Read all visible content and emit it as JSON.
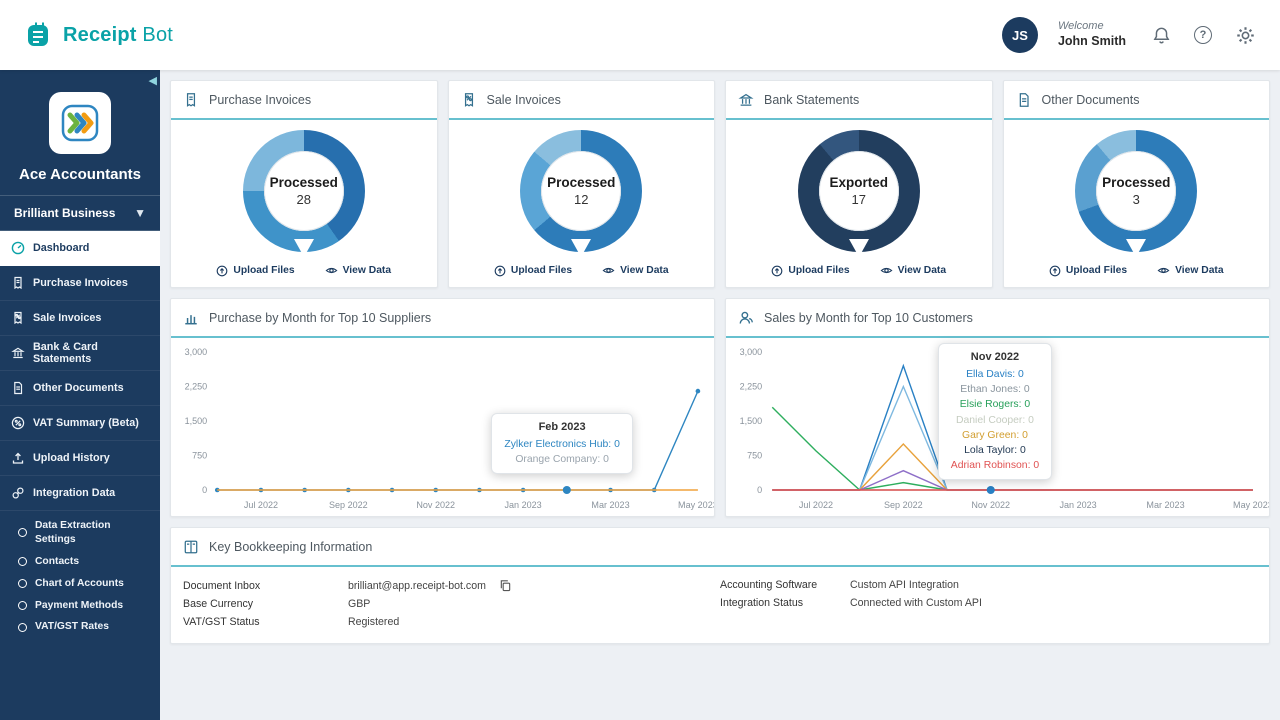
{
  "header": {
    "brand_primary": "Receipt",
    "brand_secondary": "Bot",
    "avatar_initials": "JS",
    "welcome_label": "Welcome",
    "user_name": "John Smith"
  },
  "sidebar": {
    "account_name": "Ace Accountants",
    "business_selector": "Brilliant Business",
    "items": [
      {
        "label": "Dashboard"
      },
      {
        "label": "Purchase Invoices"
      },
      {
        "label": "Sale Invoices"
      },
      {
        "label": "Bank & Card Statements"
      },
      {
        "label": "Other Documents"
      },
      {
        "label": "VAT Summary (Beta)"
      },
      {
        "label": "Upload History"
      },
      {
        "label": "Integration Data"
      }
    ],
    "integration_sub_items": [
      {
        "label": "Data Extraction Settings"
      },
      {
        "label": "Contacts"
      },
      {
        "label": "Chart of Accounts"
      },
      {
        "label": "Payment Methods"
      },
      {
        "label": "VAT/GST Rates"
      }
    ]
  },
  "summary_cards": [
    {
      "title": "Purchase Invoices",
      "status": "Processed",
      "count": "28",
      "upload_label": "Upload Files",
      "view_label": "View Data",
      "donut": {
        "segments": [
          {
            "color": "#276fae",
            "deg": 145
          },
          {
            "color": "#3f93c9",
            "deg": 125
          },
          {
            "color": "#7db7dc",
            "deg": 90
          }
        ]
      }
    },
    {
      "title": "Sale Invoices",
      "status": "Processed",
      "count": "12",
      "upload_label": "Upload Files",
      "view_label": "View Data",
      "donut": {
        "segments": [
          {
            "color": "#2d7cb9",
            "deg": 230
          },
          {
            "color": "#5aa5d6",
            "deg": 80
          },
          {
            "color": "#8abede",
            "deg": 50
          }
        ]
      }
    },
    {
      "title": "Bank Statements",
      "status": "Exported",
      "count": "17",
      "upload_label": "Upload Files",
      "view_label": "View Data",
      "donut": {
        "segments": [
          {
            "color": "#223e5e",
            "deg": 320
          },
          {
            "color": "#33567e",
            "deg": 40
          }
        ]
      }
    },
    {
      "title": "Other Documents",
      "status": "Processed",
      "count": "3",
      "upload_label": "Upload Files",
      "view_label": "View Data",
      "donut": {
        "segments": [
          {
            "color": "#2d7cb9",
            "deg": 250
          },
          {
            "color": "#5aa0d0",
            "deg": 70
          },
          {
            "color": "#8abede",
            "deg": 40
          }
        ]
      }
    }
  ],
  "chart_data": [
    {
      "type": "line",
      "title": "Purchase by Month for Top 10 Suppliers",
      "x": [
        "Jun 2022",
        "Jul 2022",
        "Aug 2022",
        "Sep 2022",
        "Oct 2022",
        "Nov 2022",
        "Dec 2022",
        "Jan 2023",
        "Feb 2023",
        "Mar 2023",
        "Apr 2023",
        "May 2023"
      ],
      "x_ticks": [
        "Jul 2022",
        "Sep 2022",
        "Nov 2022",
        "Jan 2023",
        "Mar 2023",
        "May 2023"
      ],
      "y_ticks": [
        {
          "v": 0,
          "label": "0"
        },
        {
          "v": 750,
          "label": "750"
        },
        {
          "v": 1500,
          "label": "1,500"
        },
        {
          "v": 2250,
          "label": "2,250"
        },
        {
          "v": 3000,
          "label": "3,000"
        }
      ],
      "ylim": [
        0,
        3000
      ],
      "series": [
        {
          "name": "Zylker Electronics Hub",
          "color": "#2e86c1",
          "dots": true,
          "values": [
            0,
            0,
            0,
            0,
            0,
            0,
            0,
            0,
            0,
            0,
            0,
            2150
          ]
        },
        {
          "name": "Orange Company",
          "color": "#f0a23c",
          "dots": false,
          "values": [
            0,
            0,
            0,
            0,
            0,
            0,
            0,
            0,
            0,
            0,
            0,
            0
          ]
        }
      ],
      "highlight": {
        "x_index": 8,
        "value": 0,
        "color": "#2e86c1"
      },
      "tooltip": {
        "title": "Feb 2023",
        "rows": [
          {
            "label": "Zylker Electronics Hub: 0",
            "color": "#2e86c1"
          },
          {
            "label": "Orange Company: 0",
            "color": "#9aa4ad"
          }
        ]
      }
    },
    {
      "type": "line",
      "title": "Sales by Month for Top 10 Customers",
      "x": [
        "Jun 2022",
        "Jul 2022",
        "Aug 2022",
        "Sep 2022",
        "Oct 2022",
        "Nov 2022",
        "Dec 2022",
        "Jan 2023",
        "Feb 2023",
        "Mar 2023",
        "Apr 2023",
        "May 2023"
      ],
      "x_ticks": [
        "Jul 2022",
        "Sep 2022",
        "Nov 2022",
        "Jan 2023",
        "Mar 2023",
        "May 2023"
      ],
      "y_ticks": [
        {
          "v": 0,
          "label": "0"
        },
        {
          "v": 750,
          "label": "750"
        },
        {
          "v": 1500,
          "label": "1,500"
        },
        {
          "v": 2250,
          "label": "2,250"
        },
        {
          "v": 3000,
          "label": "3,000"
        }
      ],
      "ylim": [
        0,
        3000
      ],
      "series": [
        {
          "name": "Ella Davis",
          "color": "#2980c4",
          "dots": false,
          "values": [
            0,
            0,
            0,
            2700,
            0,
            0,
            0,
            0,
            0,
            0,
            0,
            0
          ]
        },
        {
          "name": "Ethan Jones",
          "color": "#7fb9e0",
          "dots": false,
          "values": [
            0,
            0,
            0,
            2250,
            0,
            0,
            0,
            0,
            0,
            0,
            0,
            0
          ]
        },
        {
          "name": "Elsie Rogers",
          "color": "#2eae5e",
          "dots": false,
          "values": [
            1800,
            850,
            0,
            160,
            0,
            0,
            0,
            0,
            0,
            0,
            0,
            0
          ]
        },
        {
          "name": "Daniel Cooper",
          "color": "#c8cfc6",
          "dots": false,
          "values": [
            0,
            0,
            0,
            0,
            0,
            0,
            0,
            0,
            0,
            0,
            0,
            0
          ]
        },
        {
          "name": "Gary Green",
          "color": "#e8a23c",
          "dots": false,
          "values": [
            0,
            0,
            0,
            1000,
            0,
            0,
            0,
            0,
            0,
            0,
            0,
            0
          ]
        },
        {
          "name": "Lola Taylor",
          "color": "#8e6fc8",
          "dots": false,
          "values": [
            0,
            0,
            0,
            420,
            0,
            0,
            0,
            0,
            0,
            0,
            0,
            0
          ]
        },
        {
          "name": "Adrian Robinson",
          "color": "#e05252",
          "dots": false,
          "values": [
            0,
            0,
            0,
            0,
            0,
            0,
            0,
            0,
            0,
            0,
            0,
            0
          ]
        }
      ],
      "highlight": {
        "x_index": 5,
        "value": 0,
        "color": "#2980c4"
      },
      "tooltip": {
        "title": "Nov 2022",
        "rows": [
          {
            "label": "Ella Davis: 0",
            "color": "#2980c4"
          },
          {
            "label": "Ethan Jones: 0",
            "color": "#8a959e"
          },
          {
            "label": "Elsie Rogers: 0",
            "color": "#27a05a"
          },
          {
            "label": "Daniel Cooper: 0",
            "color": "#c5ccc0"
          },
          {
            "label": "Gary Green: 0",
            "color": "#d29e2f"
          },
          {
            "label": "Lola Taylor: 0",
            "color": "#233a54"
          },
          {
            "label": "Adrian Robinson: 0",
            "color": "#e05252"
          }
        ]
      }
    }
  ],
  "bookkeeping": {
    "title": "Key Bookkeeping Information",
    "left_rows": [
      {
        "label": "Document Inbox",
        "value": "brilliant@app.receipt-bot.com"
      },
      {
        "label": "Base Currency",
        "value": "GBP"
      },
      {
        "label": "VAT/GST Status",
        "value": "Registered"
      }
    ],
    "right_rows": [
      {
        "label": "Accounting Software",
        "value": "Custom API Integration"
      },
      {
        "label": "Integration Status",
        "value": "Connected with Custom API"
      }
    ]
  }
}
